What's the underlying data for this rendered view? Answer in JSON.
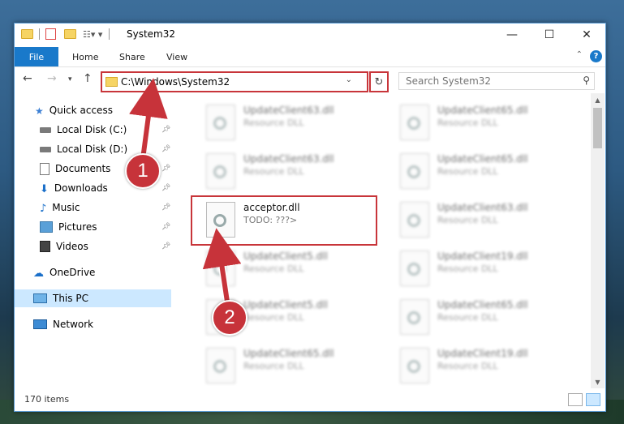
{
  "window": {
    "title": "System32"
  },
  "ribbon": {
    "tabs": [
      "File",
      "Home",
      "Share",
      "View"
    ],
    "help": "?"
  },
  "address": {
    "path": "C:\\Windows\\System32"
  },
  "search": {
    "placeholder": "Search System32"
  },
  "nav": [
    {
      "label": "Quick access",
      "icon": "star-icon",
      "pinned": false
    },
    {
      "label": "Local Disk (C:)",
      "icon": "drive-icon",
      "pinned": true
    },
    {
      "label": "Local Disk (D:)",
      "icon": "drive-icon",
      "pinned": true
    },
    {
      "label": "Documents",
      "icon": "documents-icon",
      "pinned": true
    },
    {
      "label": "Downloads",
      "icon": "download-icon",
      "pinned": true
    },
    {
      "label": "Music",
      "icon": "music-icon",
      "pinned": true
    },
    {
      "label": "Pictures",
      "icon": "pictures-icon",
      "pinned": true
    },
    {
      "label": "Videos",
      "icon": "videos-icon",
      "pinned": true
    },
    {
      "label": "OneDrive",
      "icon": "cloud-icon",
      "pinned": false
    },
    {
      "label": "This PC",
      "icon": "computer-icon",
      "pinned": false,
      "selected": true
    },
    {
      "label": "Network",
      "icon": "network-icon",
      "pinned": false
    }
  ],
  "files": {
    "left": [
      {
        "name": "UpdateClient63.dll",
        "desc": "Resource DLL"
      },
      {
        "name": "UpdateClient63.dll",
        "desc": "Resource DLL"
      },
      {
        "name": "acceptor.dll",
        "desc": "TODO: ???>"
      },
      {
        "name": "UpdateClient5.dll",
        "desc": "Resource DLL"
      },
      {
        "name": "UpdateClient5.dll",
        "desc": "Resource DLL"
      },
      {
        "name": "UpdateClient65.dll",
        "desc": "Resource DLL"
      }
    ],
    "right": [
      {
        "name": "UpdateClient65.dll",
        "desc": "Resource DLL"
      },
      {
        "name": "UpdateClient65.dll",
        "desc": "Resource DLL"
      },
      {
        "name": "UpdateClient63.dll",
        "desc": "Resource DLL"
      },
      {
        "name": "UpdateClient19.dll",
        "desc": "Resource DLL"
      },
      {
        "name": "UpdateClient65.dll",
        "desc": "Resource DLL"
      },
      {
        "name": "UpdateClient19.dll",
        "desc": "Resource DLL"
      }
    ]
  },
  "status": {
    "count": "170 items"
  },
  "annotations": {
    "step1": "1",
    "step2": "2"
  },
  "colors": {
    "accent": "#1979ca",
    "highlight": "#c8353a",
    "selected": "#cce8ff"
  }
}
